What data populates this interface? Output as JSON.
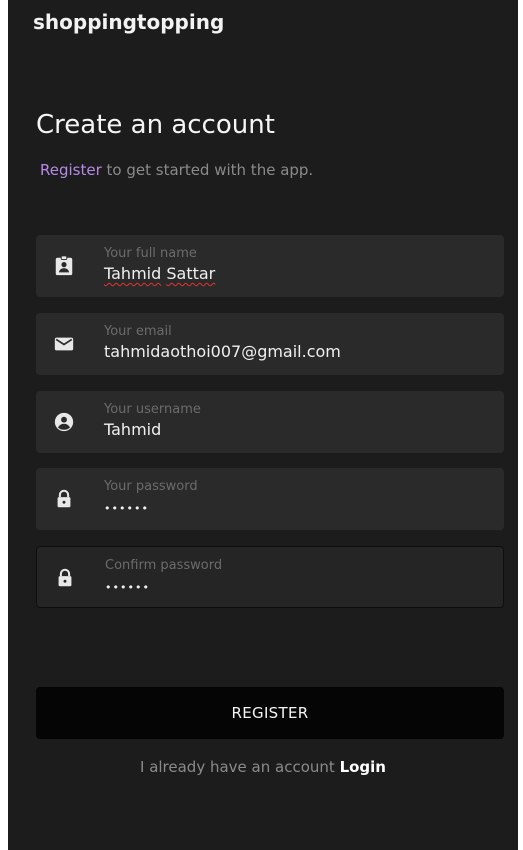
{
  "app": {
    "title": "shoppingtopping"
  },
  "header": {
    "heading": "Create an account",
    "subtitle_accent": "Register",
    "subtitle_rest": " to get started with the app."
  },
  "form": {
    "full_name": {
      "label": "Your full name",
      "value_first": "Tahmid",
      "value_last": "Sattar",
      "icon": "id-badge-icon"
    },
    "email": {
      "label": "Your email",
      "value": "tahmidaothoi007@gmail.com",
      "icon": "envelope-icon"
    },
    "username": {
      "label": "Your username",
      "value": "Tahmid",
      "icon": "user-circle-icon"
    },
    "password": {
      "label": "Your password",
      "value": "••••••",
      "icon": "lock-icon"
    },
    "confirm_password": {
      "label": "Confirm password",
      "value": "••••••",
      "icon": "lock-icon"
    }
  },
  "actions": {
    "register_label": "REGISTER",
    "login_prompt": "I already have an account",
    "login_label": "Login"
  },
  "colors": {
    "background": "#1c1c1c",
    "field_background": "#2a2a2a",
    "accent": "#b58ae6",
    "button_background": "#050505",
    "muted_text": "#8a8a8a"
  }
}
